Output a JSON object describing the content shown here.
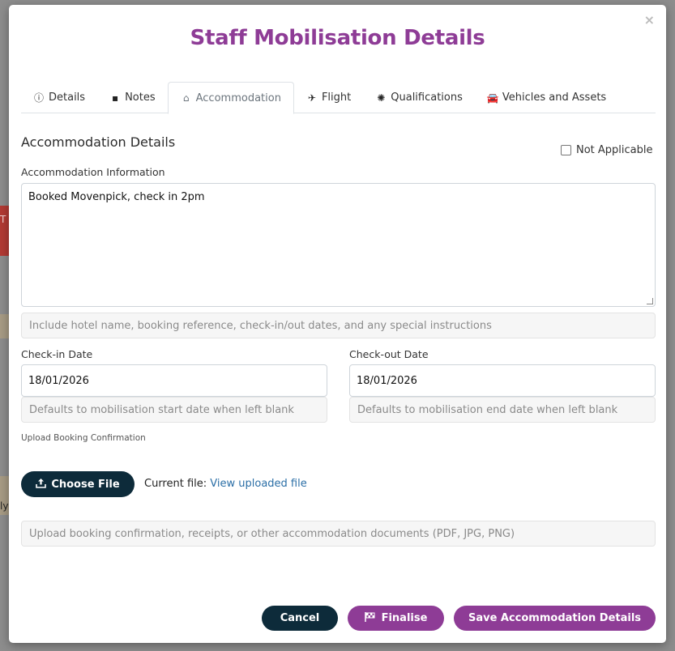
{
  "background": {
    "edge_text_1": "T",
    "edge_text_2": "ly"
  },
  "modal": {
    "title": "Staff Mobilisation Details",
    "close_glyph": "×"
  },
  "tabs": [
    {
      "label": "Details",
      "icon": "info-circle-icon",
      "glyph": "ⓘ",
      "active": false
    },
    {
      "label": "Notes",
      "icon": "sticky-note-icon",
      "glyph": "▪",
      "active": false
    },
    {
      "label": "Accommodation",
      "icon": "home-icon",
      "glyph": "⌂",
      "active": true
    },
    {
      "label": "Flight",
      "icon": "plane-icon",
      "glyph": "✈",
      "active": false
    },
    {
      "label": "Qualifications",
      "icon": "certificate-icon",
      "glyph": "✺",
      "active": false
    },
    {
      "label": "Vehicles and Assets",
      "icon": "car-icon",
      "glyph": "🚘",
      "active": false
    }
  ],
  "accommodation": {
    "section_title": "Accommodation Details",
    "not_applicable_label": "Not Applicable",
    "not_applicable_checked": false,
    "info_label": "Accommodation Information",
    "info_value": "Booked Movenpick, check in 2pm",
    "info_help": "Include hotel name, booking reference, check-in/out dates, and any special instructions",
    "checkin_label": "Check-in Date",
    "checkin_value": "18/01/2026",
    "checkin_help": "Defaults to mobilisation start date when left blank",
    "checkout_label": "Check-out Date",
    "checkout_value": "18/01/2026",
    "checkout_help": "Defaults to mobilisation end date when left blank",
    "upload_label": "Upload Booking Confirmation",
    "choose_file_label": "Choose File",
    "current_file_prefix": "Current file:",
    "current_file_link": "View uploaded file",
    "upload_help": "Upload booking confirmation, receipts, or other accommodation documents (PDF, JPG, PNG)"
  },
  "footer": {
    "cancel_label": "Cancel",
    "finalise_label": "Finalise",
    "save_label": "Save Accommodation Details"
  },
  "colors": {
    "brand_purple": "#8e3c96",
    "dark_navy": "#0d2b3a",
    "link_blue": "#2a6ea6"
  }
}
